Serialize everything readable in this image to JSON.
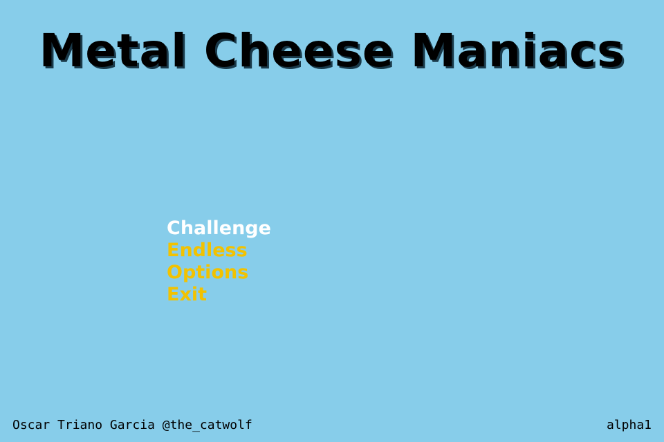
{
  "title": "Metal Cheese Maniacs",
  "colors": {
    "background": "#87CDEA",
    "title": "#000000",
    "menu_selected": "#FFFFFF",
    "menu_item": "#F2C200",
    "footer_text": "#000000"
  },
  "menu": {
    "selected_index": 0,
    "items": [
      {
        "label": "Challenge",
        "selected": true
      },
      {
        "label": "Endless",
        "selected": false
      },
      {
        "label": "Options",
        "selected": false
      },
      {
        "label": "Exit",
        "selected": false
      }
    ]
  },
  "footer": {
    "credit": "Oscar Triano Garcia @the_catwolf",
    "version": "alpha1"
  }
}
